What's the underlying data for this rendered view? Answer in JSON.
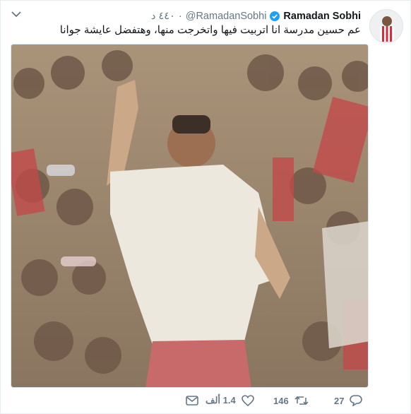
{
  "tweet": {
    "display_name": "Ramadan Sobhi",
    "handle": "@RamadanSobhi",
    "separator": "·",
    "time": "٤٤٠ د",
    "text": "عم حسين مدرسة انا اتربيت فيها واتخرجت منها، وهتفضل عايشة جوانا",
    "verified": true
  },
  "actions": {
    "reply_count": "27",
    "retweet_count": "146",
    "like_count": "1.4 ألف"
  },
  "colors": {
    "verified_blue": "#1da1f2",
    "meta_gray": "#657786",
    "text_dark": "#14171a"
  },
  "icons": {
    "menu": "chevron-down-icon",
    "verified": "verified-badge-icon",
    "reply": "reply-icon",
    "retweet": "retweet-icon",
    "like": "heart-icon",
    "message": "direct-message-icon"
  }
}
